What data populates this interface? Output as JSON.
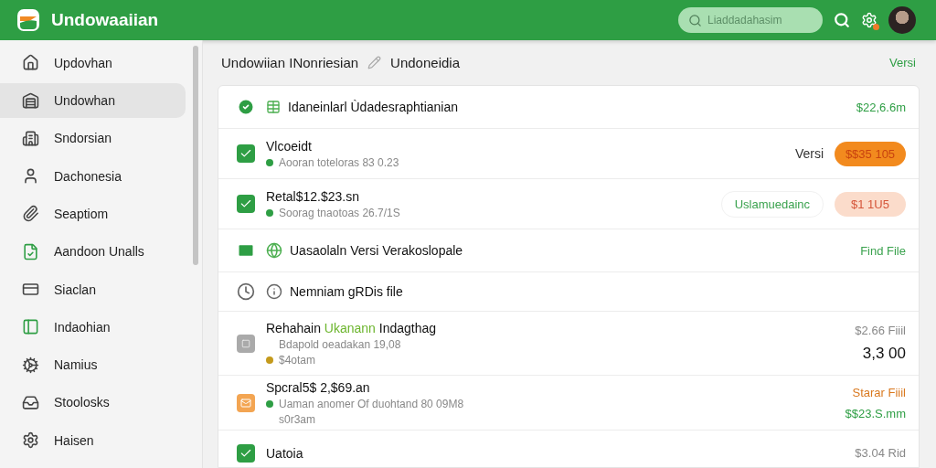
{
  "app": {
    "title": "Undowaaiian",
    "search": {
      "placeholder": "Liaddadahasim"
    },
    "notification": true
  },
  "sidebar": {
    "items": [
      {
        "label": "Updovhan",
        "selected": false
      },
      {
        "label": "Undowhan",
        "selected": true
      },
      {
        "label": "Sndorsian",
        "selected": false
      },
      {
        "label": "Dachonesia",
        "selected": false
      },
      {
        "label": "Seaptiom",
        "selected": false
      },
      {
        "label": "Aandoon Unalls",
        "selected": false
      },
      {
        "label": "Siaclan",
        "selected": false
      },
      {
        "label": "Indaohian",
        "selected": false
      },
      {
        "label": "Namius",
        "selected": false
      },
      {
        "label": "Stoolosks",
        "selected": false
      },
      {
        "label": "Haisen",
        "selected": false
      }
    ]
  },
  "breadcrumb": {
    "first": "Undowiian INonriesian",
    "second": "Undoneidia",
    "action": "Versi"
  },
  "rows": [
    {
      "title": [
        {
          "text": "Idaneinlarl Ùdadesraphtianian",
          "accent": false
        }
      ],
      "meta": [],
      "right": [
        "$22,6.6m"
      ]
    },
    {
      "title": [
        {
          "text": "Vlcoeidt",
          "accent": false
        }
      ],
      "meta": [
        {
          "text": "Aooran toteloras 83 0.23",
          "color": "#2e9e44"
        }
      ],
      "label": "Versi",
      "pill": "$$35 105",
      "right": []
    },
    {
      "title": [
        {
          "text": "Retal$12.$23.sn",
          "accent": false
        }
      ],
      "meta": [
        {
          "text": "Soorag tnaotoas 26.7/1S",
          "color": "#2e9e44"
        }
      ],
      "tag": "Uslamuedainc",
      "pill": "$1 1U5",
      "right": []
    },
    {
      "title": [
        {
          "text": "Uasaolaln Versi Verakoslopale",
          "accent": false
        }
      ],
      "meta": [],
      "link": "Find File",
      "right": []
    },
    {
      "title": [
        {
          "text": "Nemniam gRDis file",
          "accent": false
        }
      ],
      "meta": [],
      "right": []
    },
    {
      "title": [
        {
          "text": "Rehahain",
          "accent": false
        },
        {
          "text": "Ukanann",
          "accent": true
        },
        {
          "text": "Indagthag",
          "accent": false
        }
      ],
      "meta": [
        {
          "text": "Bdapold oeadakan 19,08"
        },
        {
          "text": "$4otam",
          "color": "#c49a1c"
        }
      ],
      "right": [
        "$2.66 Fiiil",
        "3,3 00"
      ]
    },
    {
      "title": [
        {
          "text": "Spcral5$ 2,$69.an",
          "accent": false
        }
      ],
      "meta": [
        {
          "text": "Uaman anomer Of duohtand 80 09M8",
          "color": "#2e9e44"
        },
        {
          "text": "s0r3am"
        }
      ],
      "right": [
        "Starar Fiiil",
        "$$23.S.mm"
      ]
    },
    {
      "title": [
        {
          "text": "Uatoia",
          "accent": false
        }
      ],
      "meta": [],
      "right": [
        "$3.04 Rid"
      ]
    }
  ]
}
